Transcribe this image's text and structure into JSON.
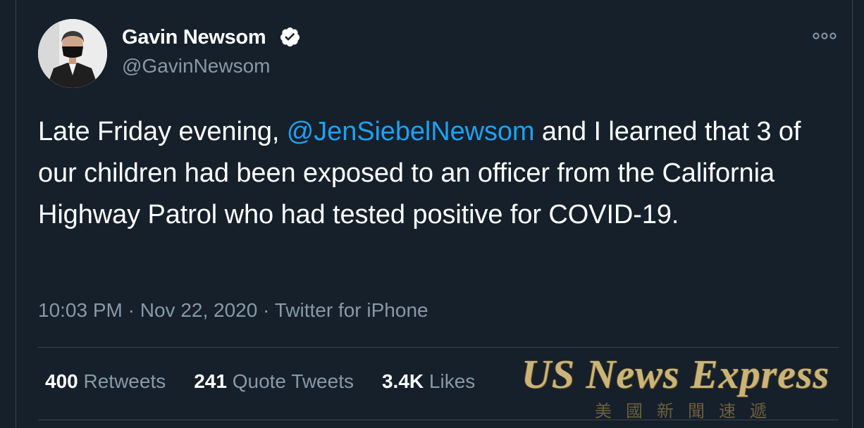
{
  "author": {
    "name": "Gavin Newsom",
    "handle": "@GavinNewsom",
    "verified": true
  },
  "tweet": {
    "text_before_mention": "Late Friday evening, ",
    "mention": "@JenSiebelNewsom",
    "text_after_mention": " and I learned that 3 of our children had been exposed to an officer from the California Highway Patrol who had tested positive for COVID-19."
  },
  "meta": {
    "time": "10:03 PM",
    "separator": " · ",
    "date": "Nov 22, 2020",
    "source": "Twitter for iPhone"
  },
  "stats": {
    "retweets_count": "400",
    "retweets_label": "Retweets",
    "quotes_count": "241",
    "quotes_label": "Quote Tweets",
    "likes_count": "3.4K",
    "likes_label": "Likes"
  },
  "watermark": {
    "title": "US News Express",
    "subtitle": "美國新聞速遞"
  },
  "icons": {
    "verified": "verified-badge-icon",
    "more": "more-dots-icon"
  },
  "colors": {
    "background": "#15202b",
    "text": "#ffffff",
    "secondary": "#8899a6",
    "accent": "#1da1f2",
    "border": "#38444d"
  }
}
